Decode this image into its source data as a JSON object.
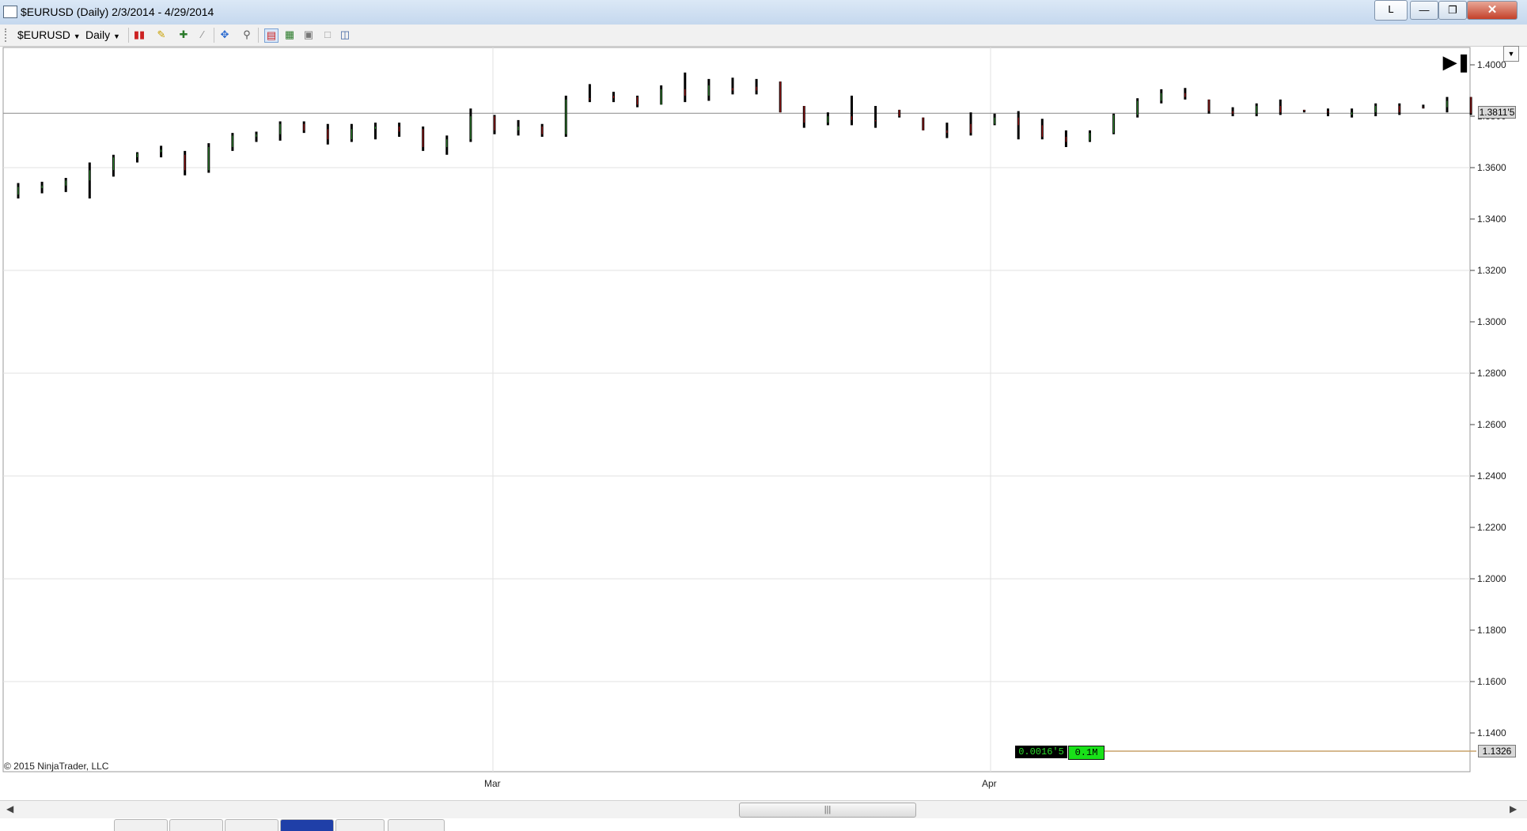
{
  "window": {
    "title": "$EURUSD (Daily)  2/3/2014 - 4/29/2014",
    "buttons": {
      "link": "L",
      "close": "✕"
    }
  },
  "toolbar": {
    "instrument": "$EURUSD",
    "interval": "Daily",
    "icons": [
      "chart-style-icon",
      "drawing-pencil-icon",
      "draw-tool-icon",
      "lines-icon",
      "crosshair-icon",
      "zoom-icon",
      "data-box-icon",
      "indicators-icon",
      "chart-properties-icon",
      "window-icon",
      "panel-icon"
    ]
  },
  "chart": {
    "copyright": "© 2015 NinjaTrader, LLC",
    "current_price_label": "1.3811'5",
    "volume_price_label": "1.1326",
    "volume_box_left": "0.0016'5",
    "volume_box_right": "0.1M",
    "x_labels": [
      "Mar",
      "Apr"
    ]
  },
  "chart_data": {
    "type": "ohlc",
    "title": "$EURUSD (Daily)",
    "ylim": [
      1.13,
      1.405
    ],
    "y_ticks": [
      "1.1400",
      "1.1600",
      "1.1800",
      "1.2000",
      "1.2200",
      "1.2400",
      "1.2600",
      "1.2800",
      "1.3000",
      "1.3200",
      "1.3400",
      "1.3600",
      "1.3800",
      "1.4000"
    ],
    "x_ticks": [
      "Mar",
      "Apr"
    ],
    "bars": [
      {
        "o": 1.3495,
        "h": 1.354,
        "l": 1.348,
        "c": 1.3525,
        "up": true
      },
      {
        "o": 1.352,
        "h": 1.3545,
        "l": 1.35,
        "c": 1.353,
        "up": true
      },
      {
        "o": 1.353,
        "h": 1.356,
        "l": 1.3505,
        "c": 1.355,
        "up": true
      },
      {
        "o": 1.355,
        "h": 1.362,
        "l": 1.348,
        "c": 1.359,
        "up": true
      },
      {
        "o": 1.359,
        "h": 1.365,
        "l": 1.3565,
        "c": 1.364,
        "up": true
      },
      {
        "o": 1.364,
        "h": 1.366,
        "l": 1.362,
        "c": 1.3655,
        "up": true
      },
      {
        "o": 1.366,
        "h": 1.3685,
        "l": 1.364,
        "c": 1.367,
        "up": true
      },
      {
        "o": 1.365,
        "h": 1.3665,
        "l": 1.357,
        "c": 1.359,
        "up": false
      },
      {
        "o": 1.359,
        "h": 1.3695,
        "l": 1.358,
        "c": 1.368,
        "up": true
      },
      {
        "o": 1.368,
        "h": 1.3735,
        "l": 1.3665,
        "c": 1.3725,
        "up": true
      },
      {
        "o": 1.372,
        "h": 1.374,
        "l": 1.37,
        "c": 1.373,
        "up": true
      },
      {
        "o": 1.373,
        "h": 1.378,
        "l": 1.3705,
        "c": 1.377,
        "up": true
      },
      {
        "o": 1.377,
        "h": 1.378,
        "l": 1.3735,
        "c": 1.3745,
        "up": false
      },
      {
        "o": 1.375,
        "h": 1.377,
        "l": 1.369,
        "c": 1.371,
        "up": false
      },
      {
        "o": 1.371,
        "h": 1.377,
        "l": 1.37,
        "c": 1.375,
        "up": true
      },
      {
        "o": 1.375,
        "h": 1.3775,
        "l": 1.371,
        "c": 1.376,
        "up": true
      },
      {
        "o": 1.376,
        "h": 1.3775,
        "l": 1.372,
        "c": 1.374,
        "up": false
      },
      {
        "o": 1.375,
        "h": 1.376,
        "l": 1.3665,
        "c": 1.368,
        "up": false
      },
      {
        "o": 1.368,
        "h": 1.3725,
        "l": 1.365,
        "c": 1.371,
        "up": true
      },
      {
        "o": 1.371,
        "h": 1.383,
        "l": 1.37,
        "c": 1.38,
        "up": true
      },
      {
        "o": 1.38,
        "h": 1.3805,
        "l": 1.373,
        "c": 1.3745,
        "up": false
      },
      {
        "o": 1.3745,
        "h": 1.3785,
        "l": 1.3725,
        "c": 1.376,
        "up": true
      },
      {
        "o": 1.376,
        "h": 1.377,
        "l": 1.372,
        "c": 1.373,
        "up": false
      },
      {
        "o": 1.373,
        "h": 1.388,
        "l": 1.372,
        "c": 1.3865,
        "up": true
      },
      {
        "o": 1.3865,
        "h": 1.3925,
        "l": 1.3855,
        "c": 1.387,
        "up": false
      },
      {
        "o": 1.387,
        "h": 1.3895,
        "l": 1.3855,
        "c": 1.388,
        "up": false
      },
      {
        "o": 1.3875,
        "h": 1.388,
        "l": 1.3835,
        "c": 1.3845,
        "up": false
      },
      {
        "o": 1.3845,
        "h": 1.392,
        "l": 1.3845,
        "c": 1.3905,
        "up": true
      },
      {
        "o": 1.3905,
        "h": 1.397,
        "l": 1.3855,
        "c": 1.388,
        "up": false
      },
      {
        "o": 1.388,
        "h": 1.3945,
        "l": 1.386,
        "c": 1.392,
        "up": true
      },
      {
        "o": 1.391,
        "h": 1.395,
        "l": 1.3885,
        "c": 1.39,
        "up": false
      },
      {
        "o": 1.3915,
        "h": 1.3945,
        "l": 1.3885,
        "c": 1.39,
        "up": false
      },
      {
        "o": 1.3935,
        "h": 1.3935,
        "l": 1.3815,
        "c": 1.3815,
        "up": false
      },
      {
        "o": 1.384,
        "h": 1.384,
        "l": 1.3755,
        "c": 1.3775,
        "up": false
      },
      {
        "o": 1.3775,
        "h": 1.3815,
        "l": 1.3765,
        "c": 1.38,
        "up": true
      },
      {
        "o": 1.38,
        "h": 1.388,
        "l": 1.3765,
        "c": 1.3785,
        "up": false
      },
      {
        "o": 1.3785,
        "h": 1.384,
        "l": 1.3755,
        "c": 1.378,
        "up": false
      },
      {
        "o": 1.3825,
        "h": 1.3825,
        "l": 1.3795,
        "c": 1.38,
        "up": false
      },
      {
        "o": 1.3795,
        "h": 1.3795,
        "l": 1.3745,
        "c": 1.3745,
        "up": false
      },
      {
        "o": 1.3745,
        "h": 1.3775,
        "l": 1.3715,
        "c": 1.3735,
        "up": false
      },
      {
        "o": 1.3735,
        "h": 1.3815,
        "l": 1.3725,
        "c": 1.377,
        "up": false
      },
      {
        "o": 1.377,
        "h": 1.381,
        "l": 1.3765,
        "c": 1.3795,
        "up": true
      },
      {
        "o": 1.3795,
        "h": 1.382,
        "l": 1.371,
        "c": 1.3765,
        "up": false
      },
      {
        "o": 1.3765,
        "h": 1.379,
        "l": 1.371,
        "c": 1.372,
        "up": false
      },
      {
        "o": 1.372,
        "h": 1.3745,
        "l": 1.368,
        "c": 1.37,
        "up": false
      },
      {
        "o": 1.3705,
        "h": 1.3745,
        "l": 1.37,
        "c": 1.3735,
        "up": true
      },
      {
        "o": 1.3735,
        "h": 1.381,
        "l": 1.373,
        "c": 1.3805,
        "up": true
      },
      {
        "o": 1.3805,
        "h": 1.387,
        "l": 1.3795,
        "c": 1.386,
        "up": true
      },
      {
        "o": 1.386,
        "h": 1.3905,
        "l": 1.385,
        "c": 1.389,
        "up": true
      },
      {
        "o": 1.389,
        "h": 1.391,
        "l": 1.3865,
        "c": 1.3875,
        "up": false
      },
      {
        "o": 1.3865,
        "h": 1.3865,
        "l": 1.381,
        "c": 1.382,
        "up": false
      },
      {
        "o": 1.382,
        "h": 1.3835,
        "l": 1.38,
        "c": 1.381,
        "up": false
      },
      {
        "o": 1.381,
        "h": 1.385,
        "l": 1.38,
        "c": 1.384,
        "up": true
      },
      {
        "o": 1.384,
        "h": 1.3865,
        "l": 1.3805,
        "c": 1.3815,
        "up": false
      },
      {
        "o": 1.3825,
        "h": 1.3825,
        "l": 1.3815,
        "c": 1.382,
        "up": false
      },
      {
        "o": 1.382,
        "h": 1.383,
        "l": 1.38,
        "c": 1.3815,
        "up": false
      },
      {
        "o": 1.3805,
        "h": 1.383,
        "l": 1.3795,
        "c": 1.3815,
        "up": true
      },
      {
        "o": 1.3815,
        "h": 1.385,
        "l": 1.38,
        "c": 1.384,
        "up": true
      },
      {
        "o": 1.384,
        "h": 1.385,
        "l": 1.3805,
        "c": 1.3815,
        "up": false
      },
      {
        "o": 1.3835,
        "h": 1.3845,
        "l": 1.383,
        "c": 1.3835,
        "up": false
      },
      {
        "o": 1.3835,
        "h": 1.3875,
        "l": 1.3815,
        "c": 1.386,
        "up": true
      },
      {
        "o": 1.3875,
        "h": 1.3875,
        "l": 1.3805,
        "c": 1.3811,
        "up": false
      }
    ],
    "last_price": 1.38115,
    "volume_line_value": 1.1326,
    "colors": {
      "up": "#3a9f3a",
      "down": "#c01b1b",
      "bar": "#000000",
      "grid": "#e2e2e2",
      "price_line": "#888888",
      "volume_line": "#c8a26a",
      "green_box": "#00d400"
    }
  }
}
